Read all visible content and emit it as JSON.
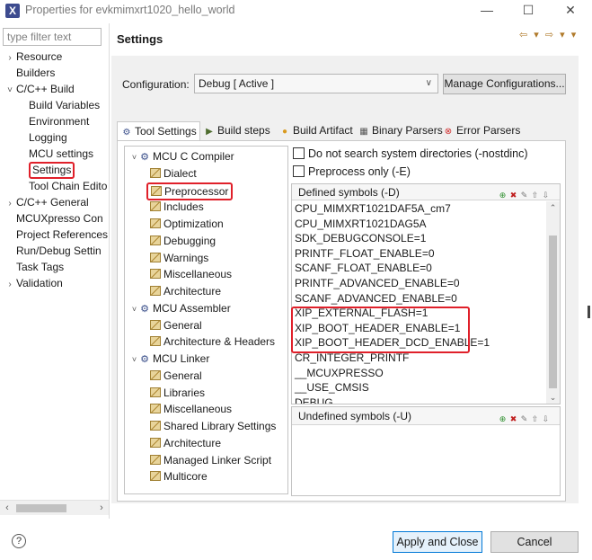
{
  "window": {
    "title": "Properties for evkmimxrt1020_hello_world",
    "controls": {
      "minimize": "—",
      "maximize": "☐",
      "close": "✕"
    }
  },
  "filter": {
    "placeholder": "type filter text",
    "value": ""
  },
  "nav_tree": [
    {
      "label": "Resource",
      "indent": 0,
      "caret": "›",
      "selected": false
    },
    {
      "label": "Builders",
      "indent": 0,
      "caret": "",
      "selected": false
    },
    {
      "label": "C/C++ Build",
      "indent": 0,
      "caret": "˅",
      "selected": false
    },
    {
      "label": "Build Variables",
      "indent": 1,
      "caret": "",
      "selected": false
    },
    {
      "label": "Environment",
      "indent": 1,
      "caret": "",
      "selected": false
    },
    {
      "label": "Logging",
      "indent": 1,
      "caret": "",
      "selected": false
    },
    {
      "label": "MCU settings",
      "indent": 1,
      "caret": "",
      "selected": false
    },
    {
      "label": "Settings",
      "indent": 1,
      "caret": "",
      "selected": true
    },
    {
      "label": "Tool Chain Edito",
      "indent": 1,
      "caret": "",
      "selected": false
    },
    {
      "label": "C/C++ General",
      "indent": 0,
      "caret": "›",
      "selected": false
    },
    {
      "label": "MCUXpresso Con",
      "indent": 0,
      "caret": "",
      "selected": false
    },
    {
      "label": "Project References",
      "indent": 0,
      "caret": "",
      "selected": false
    },
    {
      "label": "Run/Debug Settin",
      "indent": 0,
      "caret": "",
      "selected": false
    },
    {
      "label": "Task Tags",
      "indent": 0,
      "caret": "",
      "selected": false
    },
    {
      "label": "Validation",
      "indent": 0,
      "caret": "›",
      "selected": false
    }
  ],
  "page": {
    "title": "Settings",
    "nav_arrows": "⇦ ▾ ⇨ ▾ ▾"
  },
  "configuration": {
    "label": "Configuration:",
    "value": "Debug  [ Active ]",
    "manage_button": "Manage Configurations..."
  },
  "tabs": [
    {
      "label": "Tool Settings",
      "icon": "gear-icon",
      "active": true
    },
    {
      "label": "Build steps",
      "icon": "build-steps-icon",
      "active": false
    },
    {
      "label": "Build Artifact",
      "icon": "artifact-icon",
      "active": false
    },
    {
      "label": "Binary Parsers",
      "icon": "binary-icon",
      "active": false
    },
    {
      "label": "Error Parsers",
      "icon": "error-icon",
      "active": false
    }
  ],
  "tool_tree": [
    {
      "label": "MCU C Compiler",
      "type": "group"
    },
    {
      "label": "Dialect",
      "type": "leaf"
    },
    {
      "label": "Preprocessor",
      "type": "leaf",
      "highlighted": true
    },
    {
      "label": "Includes",
      "type": "leaf"
    },
    {
      "label": "Optimization",
      "type": "leaf"
    },
    {
      "label": "Debugging",
      "type": "leaf"
    },
    {
      "label": "Warnings",
      "type": "leaf"
    },
    {
      "label": "Miscellaneous",
      "type": "leaf"
    },
    {
      "label": "Architecture",
      "type": "leaf"
    },
    {
      "label": "MCU Assembler",
      "type": "group"
    },
    {
      "label": "General",
      "type": "leaf"
    },
    {
      "label": "Architecture & Headers",
      "type": "leaf"
    },
    {
      "label": "MCU Linker",
      "type": "group"
    },
    {
      "label": "General",
      "type": "leaf"
    },
    {
      "label": "Libraries",
      "type": "leaf"
    },
    {
      "label": "Miscellaneous",
      "type": "leaf"
    },
    {
      "label": "Shared Library Settings",
      "type": "leaf"
    },
    {
      "label": "Architecture",
      "type": "leaf"
    },
    {
      "label": "Managed Linker Script",
      "type": "leaf"
    },
    {
      "label": "Multicore",
      "type": "leaf"
    }
  ],
  "options": {
    "no_system_dirs": {
      "label": "Do not search system directories (-nostdinc)",
      "checked": false
    },
    "preprocess_only": {
      "label": "Preprocess only (-E)",
      "checked": false
    }
  },
  "defined_symbols": {
    "header": "Defined symbols (-D)",
    "items": [
      "CPU_MIMXRT1021DAF5A_cm7",
      "CPU_MIMXRT1021DAG5A",
      "SDK_DEBUGCONSOLE=1",
      "PRINTF_FLOAT_ENABLE=0",
      "SCANF_FLOAT_ENABLE=0",
      "PRINTF_ADVANCED_ENABLE=0",
      "SCANF_ADVANCED_ENABLE=0",
      "XIP_EXTERNAL_FLASH=1",
      "XIP_BOOT_HEADER_ENABLE=1",
      "XIP_BOOT_HEADER_DCD_ENABLE=1",
      "CR_INTEGER_PRINTF",
      "__MCUXPRESSO",
      "__USE_CMSIS",
      "DEBUG"
    ],
    "highlighted_range": [
      7,
      9
    ]
  },
  "undefined_symbols": {
    "header": "Undefined symbols (-U)",
    "items": []
  },
  "buttons": {
    "apply_close": "Apply and Close",
    "cancel": "Cancel",
    "help": "?"
  },
  "colors": {
    "highlight_box": "#e0202a",
    "default_button": "#0078d7",
    "panel_bg": "#f0f0f0"
  }
}
